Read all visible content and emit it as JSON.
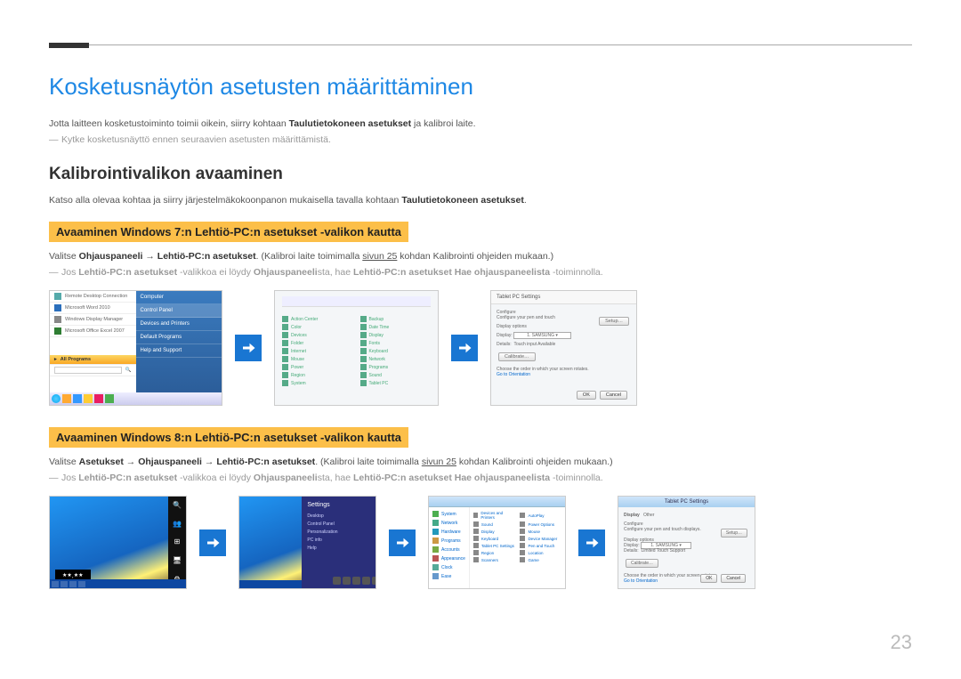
{
  "page_number": "23",
  "h1": "Kosketusnäytön asetusten määrittäminen",
  "intro_pre": "Jotta laitteen kosketustoiminto toimii oikein, siirry kohtaan ",
  "intro_bold": "Taulutietokoneen asetukset",
  "intro_post": " ja kalibroi laite.",
  "note_top": "Kytke kosketusnäyttö ennen seuraavien asetusten määrittämistä.",
  "h2": "Kalibrointivalikon avaaminen",
  "subintro_pre": "Katso alla olevaa kohtaa ja siirry järjestelmäkokoonpanon mukaisella tavalla kohtaan ",
  "subintro_bold": "Taulutietokoneen asetukset",
  "subintro_post": ".",
  "win7": {
    "band": "Avaaminen Windows 7:n Lehtiö-PC:n asetukset -valikon kautta",
    "line_a": "Valitse ",
    "line_b": "Ohjauspaneeli",
    "line_c": " → ",
    "line_d": "Lehtiö-PC:n asetukset",
    "line_e": ". (Kalibroi laite toimimalla ",
    "line_link": "sivun 25",
    "line_f": " kohdan Kalibrointi ohjeiden mukaan.)",
    "note_a": "Jos ",
    "note_b": "Lehtiö-PC:n asetukset",
    "note_c": " -valikkoa ei löydy ",
    "note_d": "Ohjauspaneeli",
    "note_e": "sta, hae ",
    "note_f": "Lehtiö-PC:n asetukset Hae ohjauspaneelista",
    "note_g": " -toiminnolla."
  },
  "win8": {
    "band": "Avaaminen Windows 8:n Lehtiö-PC:n asetukset -valikon kautta",
    "line_a": "Valitse ",
    "line_b": "Asetukset",
    "line_c": " → ",
    "line_d": "Ohjauspaneeli",
    "line_e": " → ",
    "line_f": "Lehtiö-PC:n asetukset",
    "line_g": ". (Kalibroi laite toimimalla ",
    "line_link": "sivun 25",
    "line_h": " kohdan Kalibrointi ohjeiden mukaan.)",
    "note_a": "Jos ",
    "note_b": "Lehtiö-PC:n asetukset",
    "note_c": " -valikkoa ei löydy ",
    "note_d": "Ohjauspaneeli",
    "note_e": "sta, hae ",
    "note_f": "Lehtiö-PC:n asetukset Hae ohjauspaneelista",
    "note_g": " -toiminnolla."
  },
  "sh1": {
    "r1": "Remote Desktop Connection",
    "r2": "Microsoft Word 2010",
    "r3": "Windows Display Manager",
    "r4": "Microsoft Office Excel 2007",
    "all": "All Programs",
    "c1": "Computer",
    "c2": "Control Panel",
    "c3": "Devices and Printers",
    "c4": "Default Programs",
    "c5": "Help and Support"
  },
  "sh3": {
    "title": "Tablet PC Settings",
    "cfg": "Configure",
    "setup": "Setup…",
    "disp": "Display options",
    "cal": "Calibrate…",
    "lnk": "Go to Orientation",
    "ok": "OK",
    "cancel": "Cancel"
  },
  "w8b": {
    "title": "Settings"
  }
}
